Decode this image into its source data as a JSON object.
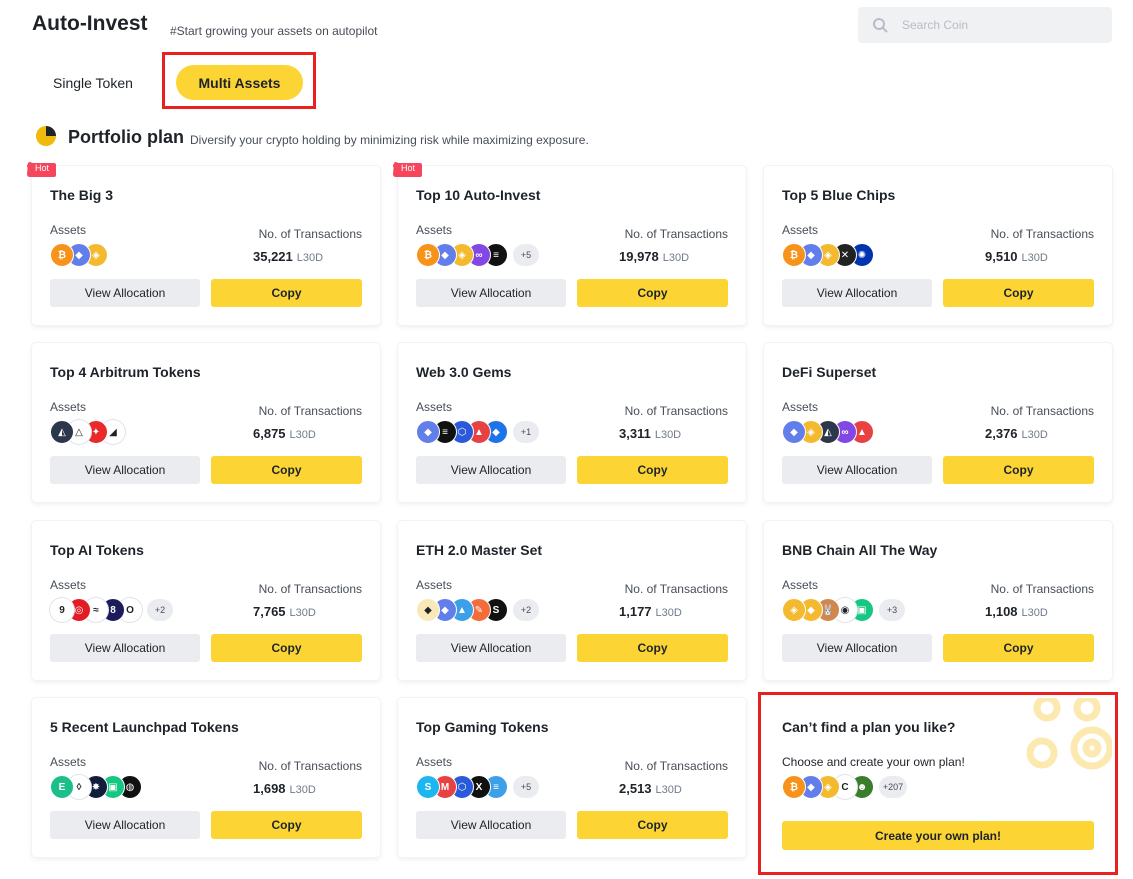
{
  "header": {
    "title": "Auto-Invest",
    "tagline": "#Start growing your assets on autopilot",
    "search_placeholder": "Search Coin"
  },
  "tabs": {
    "single": "Single Token",
    "multi": "Multi Assets",
    "active": "multi"
  },
  "section": {
    "title": "Portfolio plan",
    "desc": "Diversify your crypto holding by minimizing risk while maximizing exposure."
  },
  "labels": {
    "assets": "Assets",
    "tx": "No. of Transactions",
    "unit": "L30D",
    "view": "View Allocation",
    "copy": "Copy",
    "hot": "Hot"
  },
  "plans": [
    {
      "name": "The Big 3",
      "hot": true,
      "tx": "35,221",
      "coins": [
        [
          "#f7931a",
          "₿"
        ],
        [
          "#627eea",
          "◆"
        ],
        [
          "#f3ba2f",
          "◈"
        ]
      ],
      "more": ""
    },
    {
      "name": "Top 10 Auto-Invest",
      "hot": true,
      "tx": "19,978",
      "coins": [
        [
          "#f7931a",
          "₿"
        ],
        [
          "#627eea",
          "◆"
        ],
        [
          "#f3ba2f",
          "◈"
        ],
        [
          "#8247e5",
          "∞"
        ],
        [
          "#111111",
          "≡"
        ]
      ],
      "more": "+5"
    },
    {
      "name": "Top 5 Blue Chips",
      "hot": false,
      "tx": "9,510",
      "coins": [
        [
          "#f7931a",
          "₿"
        ],
        [
          "#627eea",
          "◆"
        ],
        [
          "#f3ba2f",
          "◈"
        ],
        [
          "#222222",
          "✕"
        ],
        [
          "#0033ad",
          "✺"
        ]
      ],
      "more": ""
    },
    {
      "name": "Top 4 Arbitrum Tokens",
      "hot": false,
      "tx": "6,875",
      "coins": [
        [
          "#2d374b",
          "◭"
        ],
        [
          "#ffffff",
          "△"
        ],
        [
          "#ea2a2a",
          "✦"
        ],
        [
          "#ffffff",
          "◢"
        ]
      ],
      "more": ""
    },
    {
      "name": "Web 3.0 Gems",
      "hot": false,
      "tx": "3,311",
      "coins": [
        [
          "#627eea",
          "◆"
        ],
        [
          "#111111",
          "≡"
        ],
        [
          "#2a5ada",
          "⬡"
        ],
        [
          "#e84142",
          "▲"
        ],
        [
          "#1d74e8",
          "◆"
        ]
      ],
      "more": "+1"
    },
    {
      "name": "DeFi Superset",
      "hot": false,
      "tx": "2,376",
      "coins": [
        [
          "#627eea",
          "◆"
        ],
        [
          "#f3ba2f",
          "◈"
        ],
        [
          "#2d374b",
          "◭"
        ],
        [
          "#8247e5",
          "∞"
        ],
        [
          "#e84142",
          "▲"
        ]
      ],
      "more": ""
    },
    {
      "name": "Top AI Tokens",
      "hot": false,
      "tx": "7,765",
      "coins": [
        [
          "#ffffff",
          "9"
        ],
        [
          "#e21b24",
          "◎"
        ],
        [
          "#ffffff",
          "≈"
        ],
        [
          "#1c1c5b",
          "8"
        ],
        [
          "#ffffff",
          "O"
        ]
      ],
      "more": "+2"
    },
    {
      "name": "ETH 2.0 Master Set",
      "hot": false,
      "tx": "1,177",
      "coins": [
        [
          "#f9e9b8",
          "◆"
        ],
        [
          "#627eea",
          "◆"
        ],
        [
          "#3ca0e8",
          "▲"
        ],
        [
          "#f46c3a",
          "✎"
        ],
        [
          "#111111",
          "S"
        ]
      ],
      "more": "+2"
    },
    {
      "name": "BNB Chain All The Way",
      "hot": false,
      "tx": "1,108",
      "coins": [
        [
          "#f3ba2f",
          "◈"
        ],
        [
          "#f3ba2f",
          "◆"
        ],
        [
          "#d1884f",
          "🐰"
        ],
        [
          "#ffffff",
          "◉"
        ],
        [
          "#16c784",
          "▣"
        ]
      ],
      "more": "+3"
    },
    {
      "name": "5 Recent Launchpad Tokens",
      "hot": false,
      "tx": "1,698",
      "coins": [
        [
          "#1bbf8a",
          "E"
        ],
        [
          "#ffffff",
          "◊"
        ],
        [
          "#111d3a",
          "✸"
        ],
        [
          "#16c784",
          "▣"
        ],
        [
          "#111111",
          "◍"
        ]
      ],
      "more": ""
    },
    {
      "name": "Top Gaming Tokens",
      "hot": false,
      "tx": "2,513",
      "coins": [
        [
          "#1eb6f0",
          "S"
        ],
        [
          "#e84142",
          "M"
        ],
        [
          "#2a5ada",
          "⬡"
        ],
        [
          "#111111",
          "X"
        ],
        [
          "#3ca0e8",
          "≡"
        ]
      ],
      "more": "+5"
    }
  ],
  "custom": {
    "title": "Can’t find a plan you like?",
    "desc": "Choose and create your own plan!",
    "coins": [
      [
        "#f7931a",
        "₿"
      ],
      [
        "#627eea",
        "◆"
      ],
      [
        "#f3ba2f",
        "◈"
      ],
      [
        "#ffffff",
        "C"
      ],
      [
        "#3a7d2d",
        "☻"
      ]
    ],
    "more": "+207",
    "button": "Create your own plan!"
  }
}
